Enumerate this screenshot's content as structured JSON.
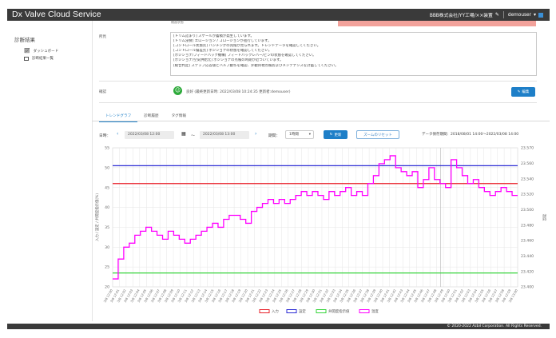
{
  "header": {
    "app_title": "Dx Valve Cloud Service",
    "site_path": "BBB株式会社/YY工場/××装置",
    "user": "demouser"
  },
  "sidebar": {
    "title": "診断結果",
    "items": [
      {
        "label": "ダッシュボード",
        "icon": "chart-icon"
      },
      {
        "label": "診断結果一覧",
        "icon": "table-icon"
      }
    ]
  },
  "detail": {
    "top_cell_text": "機器状態",
    "comment_label": "所見",
    "lines": [
      "[トリム詰まり] スケールが蓄積が発生しています。",
      "[トリム浸食] エロージョン / コロージョンが進行しています。",
      "[コントロール状態劣] ハンチングの兆候が見られます。トレンドデータを確認してください。",
      "[コントロール偏差劣] ポジショナの状態を確認してください。",
      "[ポジショナ/フィードバック機構] フィードバックレバー/ピンの状態を確認してください。",
      "[ポジショナ/空気供給元] ポジショナの点検の時期が近づいています。",
      "[総合判定] ステップ応答値とバルブ動作を確認、外観目視点検およびメンテナンスを計画してください。"
    ],
    "confirm_label": "確認",
    "status_text": "良好 (最終更新日時: 2022/03/08 10:24:35 更新者:demouser)",
    "edit_button": "編集"
  },
  "tabs": [
    {
      "label": "トレンドグラフ",
      "active": true
    },
    {
      "label": "診断履歴",
      "active": false
    },
    {
      "label": "タグ情報",
      "active": false
    }
  ],
  "controls": {
    "date_label": "日時：",
    "start_date": "2022/03/08 12:00",
    "tilde": "～",
    "end_date": "2022/03/08 13:00",
    "period_label": "期間：",
    "period_value": "1時間",
    "update_button": "更新",
    "zoom_reset_button": "ズームのリセット",
    "data_period": "データ保存期間：2018/08/01 14:00～2022/03/08 14:00"
  },
  "chart_data": {
    "type": "line",
    "y_left": {
      "label": "入力 / 設定 / 弁開度指示値(%)",
      "min": 20,
      "max": 55,
      "ticks": [
        20,
        25,
        30,
        35,
        40,
        45,
        50,
        55
      ]
    },
    "y_right": {
      "label": "温度",
      "min": 23.4,
      "max": 23.57,
      "ticks": [
        "23.400",
        "23.420",
        "23.440",
        "23.460",
        "23.480",
        "23.500",
        "23.520",
        "23.540",
        "23.560",
        "23.570"
      ]
    },
    "x_tick_labels": [
      "3/8 12:00",
      "3/8 12:01",
      "3/8 12:02",
      "3/8 12:03",
      "3/8 12:04",
      "3/8 12:05",
      "3/8 12:06",
      "3/8 12:07",
      "3/8 12:08",
      "3/8 12:09",
      "3/8 12:10",
      "3/8 12:11",
      "3/8 12:12",
      "3/8 12:13",
      "3/8 12:14",
      "3/8 12:15",
      "3/8 12:16",
      "3/8 12:17",
      "3/8 12:18",
      "3/8 12:19",
      "3/8 12:20",
      "3/8 12:21",
      "3/8 12:22",
      "3/8 12:23",
      "3/8 12:24",
      "3/8 12:25",
      "3/8 12:26",
      "3/8 12:27",
      "3/8 12:28",
      "3/8 12:29",
      "3/8 12:30",
      "3/8 12:31",
      "3/8 12:32",
      "3/8 12:33",
      "3/8 12:34",
      "3/8 12:35",
      "3/8 12:36",
      "3/8 12:37",
      "3/8 12:38",
      "3/8 12:39",
      "3/8 12:40",
      "3/8 12:41",
      "3/8 12:42",
      "3/8 12:43",
      "3/8 12:44",
      "3/8 12:45",
      "3/8 12:46",
      "3/8 12:47",
      "3/8 12:48",
      "3/8 12:49",
      "3/8 12:50",
      "3/8 12:51",
      "3/8 12:52",
      "3/8 12:53",
      "3/8 12:54",
      "3/8 12:55",
      "3/8 12:56",
      "3/8 12:57",
      "3/8 12:58",
      "3/8 12:59",
      "3/8 13:00"
    ],
    "series": [
      {
        "name": "入力",
        "color": "#e8212a",
        "values": [
          46,
          46
        ]
      },
      {
        "name": "設定",
        "color": "#2a2ad4",
        "values": [
          50.5,
          50.5
        ]
      },
      {
        "name": "弁開度指示値",
        "color": "#35d43a",
        "values": [
          23.5,
          23.5
        ]
      },
      {
        "name": "温度",
        "color": "#ff00ff",
        "values": [
          22,
          27,
          30,
          31,
          33,
          34,
          35,
          34,
          33,
          32,
          34,
          33,
          32,
          31,
          32,
          33,
          34,
          35,
          36,
          35,
          37,
          38,
          38,
          37,
          36,
          39,
          40,
          41,
          42,
          41,
          42,
          41,
          42,
          43,
          44,
          43,
          44,
          43,
          42,
          44,
          43,
          44,
          45,
          43,
          44,
          43,
          46,
          48,
          51,
          52,
          53,
          50,
          49,
          48,
          49,
          45,
          47,
          50,
          47,
          46,
          45,
          52,
          50,
          48,
          46,
          47,
          45,
          44,
          43,
          44,
          45,
          44,
          43
        ]
      }
    ],
    "grid": true,
    "legend": "bottom"
  },
  "footer": {
    "copyright": "© 2020-2022 Azbil Corporation. All Rights Reserved."
  }
}
